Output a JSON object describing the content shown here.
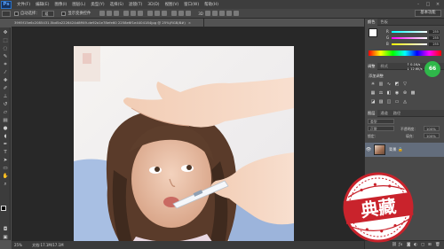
{
  "app": {
    "logo": "Ps",
    "menu": [
      "文件(F)",
      "编辑(E)",
      "图像(I)",
      "图层(L)",
      "类型(Y)",
      "选择(S)",
      "滤镜(T)",
      "3D(D)",
      "视图(V)",
      "窗口(W)",
      "帮助(H)"
    ],
    "window_controls": [
      "-",
      "□",
      "×"
    ]
  },
  "options_bar": {
    "auto_select_label": "自动选择：",
    "auto_select_value": "组",
    "show_transform_label": "显示变换控件",
    "workspace": "基本功能"
  },
  "document": {
    "tab_title": "3995f15e6c2085431.5bd5a2226424d8ff49-de92a1e78efe60 2258e6f1e4404184jpg @ 25%(RGB/8#)",
    "tab_close": "×"
  },
  "status_bar": {
    "zoom": "25%",
    "doc_size": "文档:17.1M/17.1M"
  },
  "color_panel": {
    "tabs": [
      "颜色",
      "色板"
    ],
    "sliders": [
      {
        "label": "R",
        "value": "255"
      },
      {
        "label": "G",
        "value": "255"
      },
      {
        "label": "B",
        "value": "255"
      }
    ],
    "colors": {
      "fg": "#000000",
      "bg": "#ffffff"
    }
  },
  "adjustments_panel": {
    "tabs": [
      "调整",
      "样式"
    ],
    "title": "添加调整",
    "row1_icons": [
      "brightness-icon",
      "levels-icon",
      "curves-icon",
      "exposure-icon",
      "vibrance-icon"
    ],
    "row2_icons": [
      "hue-icon",
      "balance-icon",
      "bw-icon",
      "photo-filter-icon",
      "channel-mixer-icon",
      "lookup-icon"
    ],
    "row3_icons": [
      "invert-icon",
      "posterize-icon",
      "threshold-icon",
      "gradient-map-icon",
      "selective-color-icon"
    ]
  },
  "layers_panel": {
    "tabs": [
      "图层",
      "通道",
      "路径"
    ],
    "kind_label": "类型",
    "blend_mode": "正常",
    "opacity_label": "不透明度：",
    "opacity_value": "100%",
    "lock_label": "锁定：",
    "fill_label": "填充：",
    "fill_value": "100%",
    "layer_name": "背景",
    "lock_icon": "🔒"
  },
  "badge": {
    "value": "66",
    "line1": "↑ 0.1K/s",
    "line2": "↓ 12.6K/s"
  },
  "stamp": {
    "text": "典藏"
  }
}
